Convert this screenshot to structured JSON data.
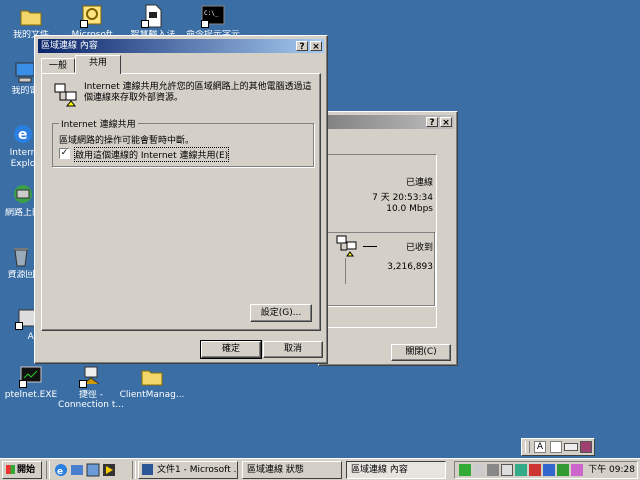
{
  "desktop": {
    "icons": [
      {
        "label": "我的文件"
      },
      {
        "label": "Microsoft"
      },
      {
        "label": "智慧輸入法"
      },
      {
        "label": "命令提示字元"
      },
      {
        "label": "我的電"
      },
      {
        "label": "Intern Explo"
      },
      {
        "label": "網路上的"
      },
      {
        "label": "資源回"
      },
      {
        "label": "ADS"
      },
      {
        "label": "ptelnet.EXE"
      },
      {
        "label": "捷徑 - Connection t..."
      },
      {
        "label": "ClientManag..."
      }
    ]
  },
  "status_window": {
    "title_help": "?",
    "title_close": "×",
    "connection_status": "已連線",
    "duration": "7 天 20:53:34",
    "speed": "10.0 Mbps",
    "received_label": "已收到",
    "received_value": "3,216,893",
    "close_button": "關閉(C)"
  },
  "props_window": {
    "title": "區域連線 內容",
    "title_help": "?",
    "title_close": "×",
    "tabs": [
      "一般",
      "共用"
    ],
    "description": "Internet 連線共用允許您的區域網路上的其他電腦透過這個連線來存取外部資源。",
    "group_label": "Internet 連線共用",
    "note": "區域網路的操作可能會暫時中斷。",
    "checkbox_label": "啟用這個連線的 Internet 連線共用(E)",
    "checkbox_checked": true,
    "settings_button": "設定(G)...",
    "ok_button": "確定",
    "cancel_button": "取消"
  },
  "taskbar": {
    "start": "開始",
    "tasks": [
      "文件1 - Microsoft ...",
      "區域連線 狀態",
      "區域連線 內容"
    ],
    "clock": "下午 09:28",
    "ime_mode": "A"
  }
}
